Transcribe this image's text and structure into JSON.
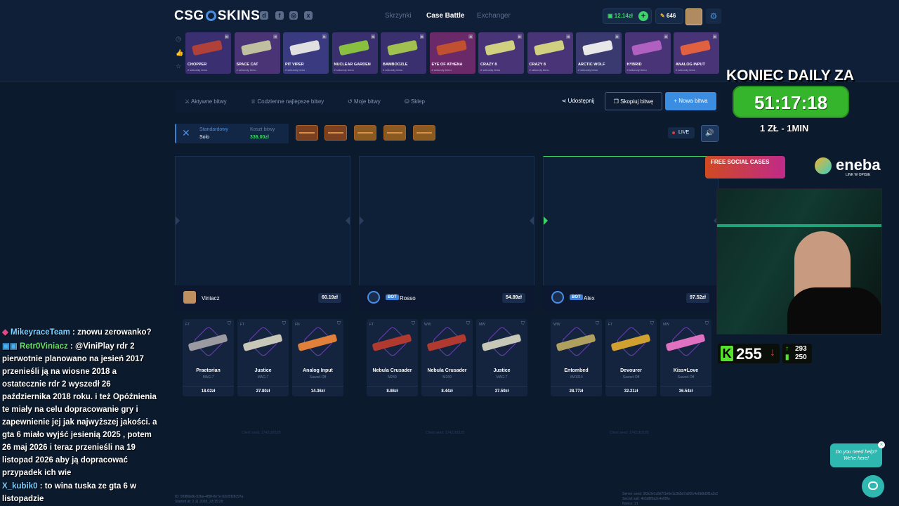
{
  "header": {
    "logo_left": "CSG",
    "logo_right": "SKINS",
    "nav": [
      "Skrzynki",
      "Case Battle",
      "Exchanger"
    ],
    "balance": "12.14zł",
    "points": "646"
  },
  "drops": [
    {
      "name": "CHOPPER",
      "time": "2 sekundy temu",
      "color": "#3a2f70",
      "gun": "#b0403a"
    },
    {
      "name": "SPACE CAT",
      "time": "2 sekundy temu",
      "color": "#4a3475",
      "gun": "#c0c0a0"
    },
    {
      "name": "PIT VIPER",
      "time": "2 sekundy temu",
      "color": "#3a3a80",
      "gun": "#e0e0e0"
    },
    {
      "name": "NUCLEAR GARDEN",
      "time": "2 sekundy temu",
      "color": "#3a3070",
      "gun": "#8ac040"
    },
    {
      "name": "BAMBOOZLE",
      "time": "2 sekundy temu",
      "color": "#3a3070",
      "gun": "#a0c050"
    },
    {
      "name": "EYE OF ATHENA",
      "time": "2 sekundy temu",
      "color": "#6a2a6a",
      "gun": "#c05030"
    },
    {
      "name": "CRAZY 8",
      "time": "2 sekundy temu",
      "color": "#4a3478",
      "gun": "#d0d080"
    },
    {
      "name": "CRAZY 8",
      "time": "2 sekundy temu",
      "color": "#4a3478",
      "gun": "#d0d080"
    },
    {
      "name": "ARCTIC WOLF",
      "time": "2 sekundy temu",
      "color": "#3a3a70",
      "gun": "#e8e8e8"
    },
    {
      "name": "HYBRID",
      "time": "2 sekundy temu",
      "color": "#4a3478",
      "gun": "#b060c0"
    },
    {
      "name": "ANALOG INPUT",
      "time": "2 sekundy temu",
      "color": "#4a3478",
      "gun": "#e06040"
    }
  ],
  "toolbar": {
    "tabs": [
      "Aktywne bitwy",
      "Codzienne najlepsze bitwy",
      "Moje bitwy",
      "Sklep"
    ],
    "share": "Udostępnij",
    "copy": "Skopiuj bitwę",
    "new": "+ Nowa bitwa"
  },
  "battle": {
    "mode": "Standardowy",
    "type": "Solo",
    "cost_label": "Koszt bitwy",
    "cost": "336.00zł",
    "live": "LIVE"
  },
  "players": [
    {
      "name": "Viniacz",
      "bot": false,
      "total": "60.19zł",
      "seed": "Client seed: 17421b5185",
      "items": [
        {
          "cond": "FT",
          "name": "Praetorian",
          "type": "MAG-7",
          "price": "18.02zł",
          "gun": "#9a9aa0"
        },
        {
          "cond": "FT",
          "name": "Justice",
          "type": "MAG-7",
          "price": "27.80zł",
          "gun": "#c8c8b8"
        },
        {
          "cond": "FN",
          "name": "Analog Input",
          "type": "Sawed-Off",
          "price": "14.36zł",
          "gun": "#e0803a"
        }
      ]
    },
    {
      "name": "Rosso",
      "bot": true,
      "total": "54.89zł",
      "seed": "Client seed: 17421b5185",
      "items": [
        {
          "cond": "FT",
          "name": "Nebula Crusader",
          "type": "M249",
          "price": "8.86zł",
          "gun": "#b03a30"
        },
        {
          "cond": "WW",
          "name": "Nebula Crusader",
          "type": "M249",
          "price": "8.44zł",
          "gun": "#b03a30"
        },
        {
          "cond": "MW",
          "name": "Justice",
          "type": "MAG-7",
          "price": "37.59zł",
          "gun": "#c8c8b8"
        }
      ]
    },
    {
      "name": "Alex",
      "bot": true,
      "total": "97.52zł",
      "seed": "Client seed: 17421b5185",
      "items": [
        {
          "cond": "WW",
          "name": "Entombed",
          "type": "XM1014",
          "price": "28.77zł",
          "gun": "#b0a060"
        },
        {
          "cond": "FT",
          "name": "Devourer",
          "type": "Sawed-Off",
          "price": "32.21zł",
          "gun": "#d0a030"
        },
        {
          "cond": "MW",
          "name": "Kiss♥Love",
          "type": "Sawed-Off",
          "price": "36.54zł",
          "gun": "#e070c0"
        }
      ]
    }
  ],
  "footer": {
    "id": "ID: 5f086bdb-92be-489f-8e7e-93cf2f28c97a",
    "started": "Started at: 2.11.2025, 23:15:29",
    "server_seed": "Server seed: 9f3c0e1c8d7f1e6e1c3b5d7a9f2c4e6b8d0f1a3c5e7b9d1f",
    "secret": "Secret salt: 4b6d8f0a2c4e6f8a",
    "nonce": "Nonce: 21"
  },
  "chat": [
    {
      "user": "MikeyraceTeam",
      "text": " : znowu zerowanko?"
    },
    {
      "user": "Retr0Viniacz",
      "text": " : @ViniPlay rdr 2 pierwotnie planowano na jesień 2017 przenieśli ją na wiosne 2018 a ostatecznie rdr 2 wyszedł 26 października 2018 roku. i też Opóźnienia te miały na celu dopracowanie gry i zapewnienie jej jak najwyższej jakości. a gta 6 miało wyjść jesienią 2025 , potem 26 maj 2026 i teraz przenieśli na 19 listopad 2026 aby ją dopracować przypadek"
    },
    {
      "user": "",
      "text": "ich wie"
    },
    {
      "user": "X_kubik0",
      "text": " : to wina tuska ze gta 6 w listopadzie"
    }
  ],
  "overlay": {
    "daily": "KONIEC DAILY ZA",
    "timer": "51:17:18",
    "rate": "1 ZŁ - 1MIN",
    "free": "FREE SOCIAL CASES",
    "sponsor": "eneba",
    "sponsor_sub": "LINK W OPISIE",
    "kick_count": "255",
    "stat1": "293",
    "stat2": "250",
    "help": "Do you need help? We're here!"
  }
}
